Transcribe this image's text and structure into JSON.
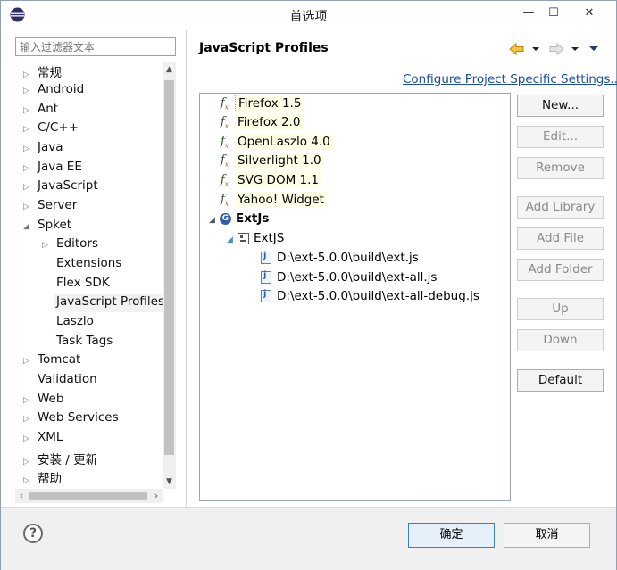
{
  "window": {
    "title": "首选项",
    "minimize_glyph": "—",
    "maximize_glyph": "☐",
    "close_glyph": "✕"
  },
  "sidebar": {
    "filter_placeholder": "输入过滤器文本",
    "items": [
      {
        "label": "常规",
        "expandable": true
      },
      {
        "label": "Android",
        "expandable": true
      },
      {
        "label": "Ant",
        "expandable": true
      },
      {
        "label": "C/C++",
        "expandable": true
      },
      {
        "label": "Java",
        "expandable": true
      },
      {
        "label": "Java EE",
        "expandable": true
      },
      {
        "label": "JavaScript",
        "expandable": true
      },
      {
        "label": "Server",
        "expandable": true
      },
      {
        "label": "Spket",
        "expanded": true
      },
      {
        "label": "Editors",
        "expandable": true
      },
      {
        "label": "Extensions"
      },
      {
        "label": "Flex SDK"
      },
      {
        "label": "JavaScript Profiles",
        "selected": true
      },
      {
        "label": "Laszlo"
      },
      {
        "label": "Task Tags"
      },
      {
        "label": "Tomcat",
        "expandable": true
      },
      {
        "label": "Validation"
      },
      {
        "label": "Web",
        "expandable": true
      },
      {
        "label": "Web Services",
        "expandable": true
      },
      {
        "label": "XML",
        "expandable": true
      },
      {
        "label": "安装 / 更新",
        "expandable": true
      },
      {
        "label": "帮助",
        "expandable": true
      }
    ]
  },
  "panel": {
    "title": "JavaScript Profiles",
    "configure_link": "Configure Project Specific Settings...",
    "profiles": [
      {
        "label": "Firefox 1.5"
      },
      {
        "label": "Firefox 2.0"
      },
      {
        "label": "OpenLaszlo 4.0"
      },
      {
        "label": "Silverlight 1.0"
      },
      {
        "label": "SVG DOM 1.1"
      },
      {
        "label": "Yahoo! Widget"
      }
    ],
    "extjs": {
      "label": "ExtJs",
      "library": "ExtJS",
      "files": [
        "D:\\ext-5.0.0\\build\\ext.js",
        "D:\\ext-5.0.0\\build\\ext-all.js",
        "D:\\ext-5.0.0\\build\\ext-all-debug.js"
      ]
    },
    "buttons": {
      "new": "New...",
      "edit": "Edit...",
      "remove": "Remove",
      "add_library": "Add Library",
      "add_file": "Add File",
      "add_folder": "Add Folder",
      "up": "Up",
      "down": "Down",
      "default": "Default"
    }
  },
  "footer": {
    "help_glyph": "?",
    "ok": "确定",
    "cancel": "取消"
  },
  "icons": {
    "back": "back-arrow-icon",
    "forward": "forward-arrow-icon",
    "menu": "view-menu-icon",
    "profile": "function-icon",
    "group": "global-icon",
    "library": "library-icon",
    "file": "js-file-icon"
  }
}
